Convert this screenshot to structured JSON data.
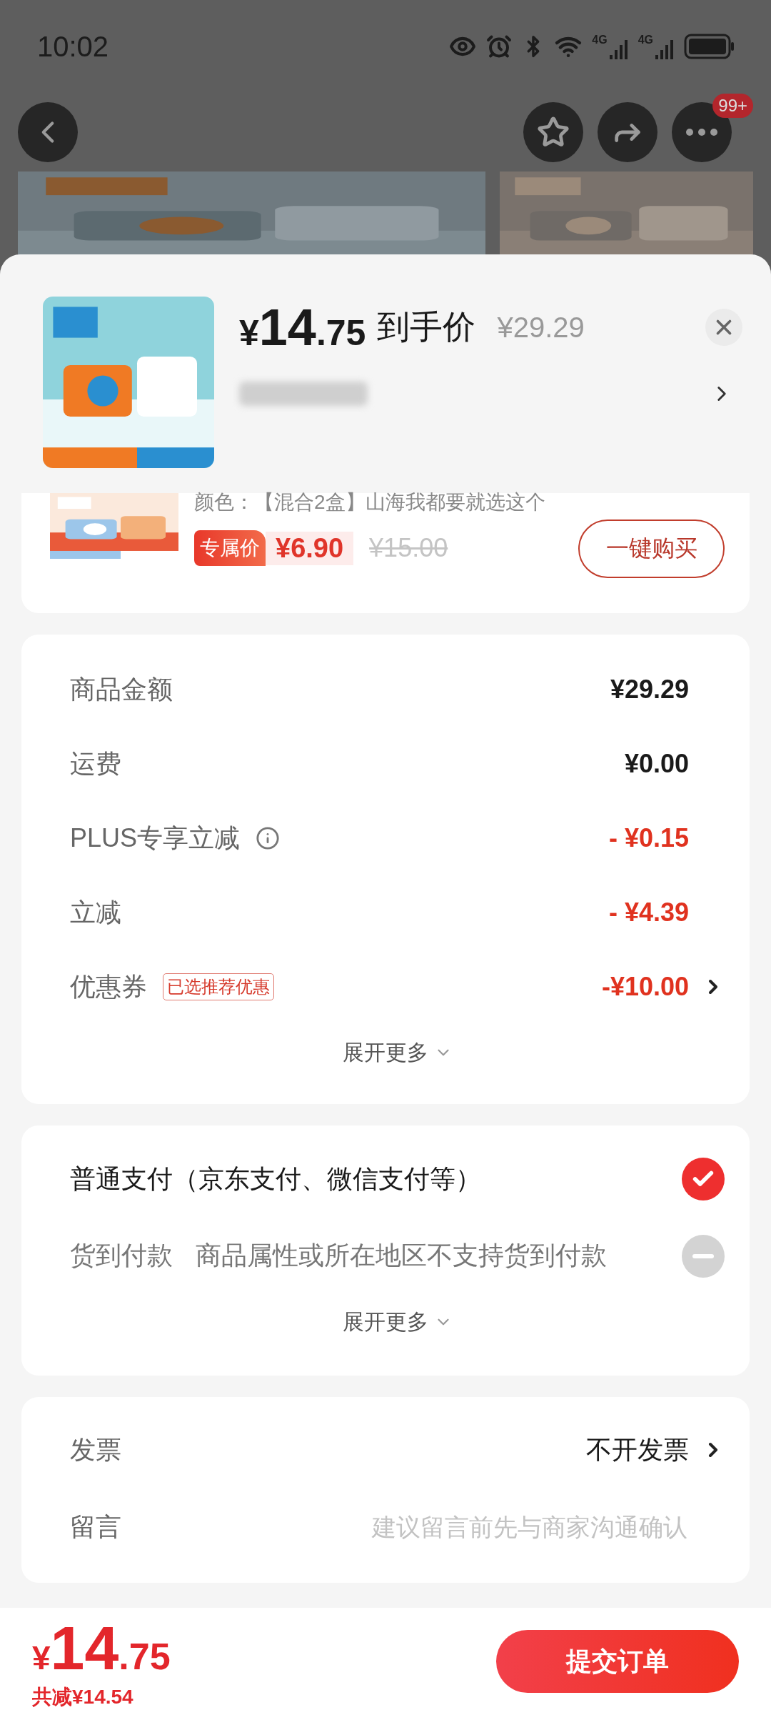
{
  "status_bar": {
    "time": "10:02",
    "networks": [
      "4G",
      "4G"
    ]
  },
  "nav": {
    "badge": "99+"
  },
  "sheet_header": {
    "price_symbol": "¥",
    "price_int": "14",
    "price_dec": ".75",
    "price_label": "到手价",
    "original_price": "¥29.29"
  },
  "item": {
    "spec": "颜色：【混合2盒】山海我都要就选这个",
    "tag": "专属价",
    "price": "¥6.90",
    "old_price": "¥15.00",
    "buy_button": "一键购买"
  },
  "price_rows": [
    {
      "label": "商品金额",
      "value": "¥29.29",
      "kind": "amount",
      "info": false,
      "link": false
    },
    {
      "label": "运费",
      "value": "¥0.00",
      "kind": "amount",
      "info": false,
      "link": false
    },
    {
      "label": "PLUS专享立减",
      "value": "- ¥0.15",
      "kind": "discount",
      "info": true,
      "link": false
    },
    {
      "label": "立减",
      "value": "- ¥4.39",
      "kind": "discount",
      "info": false,
      "link": false
    },
    {
      "label": "优惠券",
      "badge": "已选推荐优惠",
      "value": "-¥10.00",
      "kind": "discount",
      "info": false,
      "link": true
    }
  ],
  "price_expand": "展开更多",
  "payment_options": [
    {
      "label": "普通支付（京东支付、微信支付等）",
      "selected": true,
      "disabled": false
    },
    {
      "label": "货到付款",
      "note": "商品属性或所在地区不支持货到付款",
      "selected": false,
      "disabled": true
    }
  ],
  "payment_expand": "展开更多",
  "extras": [
    {
      "kind": "link",
      "label": "发票",
      "value": "不开发票"
    },
    {
      "kind": "input",
      "label": "留言",
      "placeholder": "建议留言前先与商家沟通确认"
    }
  ],
  "footer": {
    "symbol": "¥",
    "int": "14",
    "dec": ".75",
    "saving": "共减¥14.54",
    "submit": "提交订单"
  }
}
